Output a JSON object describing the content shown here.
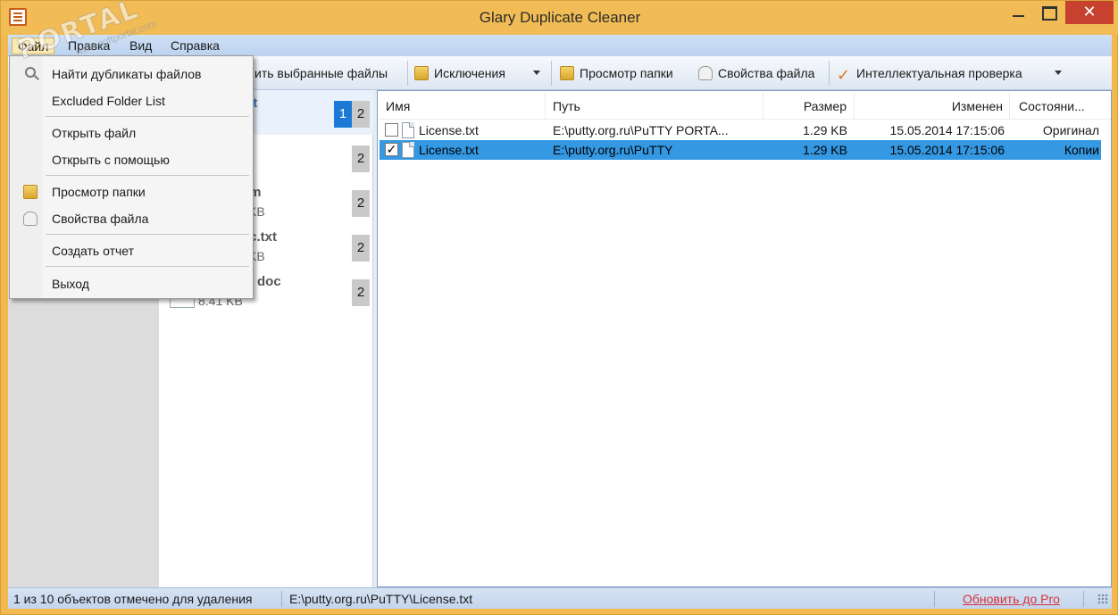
{
  "window": {
    "title": "Glary Duplicate Cleaner",
    "close_glyph": "✕"
  },
  "menubar": [
    "Файл",
    "Правка",
    "Вид",
    "Справка"
  ],
  "toolbar": {
    "delete_selected": "ить выбранные файлы",
    "exclusions": "Исключения",
    "view_folder": "Просмотр папки",
    "file_properties": "Свойства файла",
    "smart_check": "Интеллектуальная проверка"
  },
  "groups": [
    {
      "name": "txt",
      "size": "",
      "count_a": "1",
      "count_b": "2"
    },
    {
      "name": "",
      "size": "",
      "count_b": "2"
    },
    {
      "name": "nm",
      "size": "KB",
      "count_b": "2"
    },
    {
      "name": "oc.txt",
      "size": "KB",
      "count_b": "2"
    },
    {
      "name": "doc",
      "size": "8.41 KB",
      "count_b": "2"
    }
  ],
  "file_grid": {
    "columns": [
      "Имя",
      "Путь",
      "Размер",
      "Изменен",
      "Состояни..."
    ],
    "rows": [
      {
        "checked": false,
        "name": "License.txt",
        "path": "E:\\putty.org.ru\\PuTTY PORTA...",
        "size": "1.29 KB",
        "modified": "15.05.2014 17:15:06",
        "state": "Оригинал"
      },
      {
        "checked": true,
        "name": "License.txt",
        "path": "E:\\putty.org.ru\\PuTTY",
        "size": "1.29 KB",
        "modified": "15.05.2014 17:15:06",
        "state": "Копии"
      }
    ]
  },
  "file_menu": {
    "items": [
      "Найти дубликаты файлов",
      "Excluded Folder List",
      "Открыть файл",
      "Открыть с помощью",
      "Просмотр папки",
      "Свойства файла",
      "Создать отчет",
      "Выход"
    ]
  },
  "status": {
    "marked": "1 из 10 объектов отмечено для удаления",
    "path": "E:\\putty.org.ru\\PuTTY\\License.txt",
    "upgrade": "Обновить до Pro"
  },
  "watermark": {
    "text": "PORTAL",
    "sub": "www.softportal.com"
  },
  "colors": {
    "titlebar": "#f1bc55",
    "close_button": "#c7412f",
    "selection": "#3498e2",
    "count_highlight": "#1c7ad6",
    "upgrade_link": "#d8323c"
  }
}
